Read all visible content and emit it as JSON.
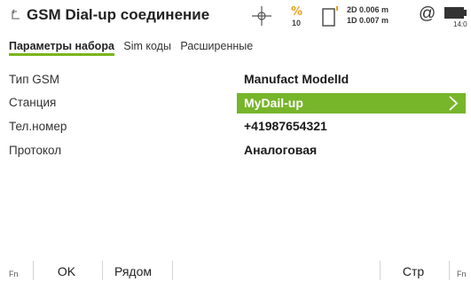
{
  "header": {
    "title": "GSM Dial-up соединение",
    "satellite_count": "10",
    "precision_2d": "2D 0.006 m",
    "precision_1d": "1D 0.007 m",
    "time": "14:0",
    "icons": [
      "back-icon",
      "crosshair-icon",
      "satellite-icon",
      "device-icon",
      "at-icon",
      "battery-icon"
    ]
  },
  "tabs": [
    {
      "label": "Параметры набора",
      "active": true
    },
    {
      "label": "Sim коды",
      "active": false
    },
    {
      "label": "Расширенные",
      "active": false
    }
  ],
  "fields": [
    {
      "label": "Тип GSM",
      "value": "Manufact ModelId"
    },
    {
      "label": "Станция",
      "value": "MyDail-up",
      "selected": true
    },
    {
      "label": "Тел.номер",
      "value": "+41987654321"
    },
    {
      "label": "Протокол",
      "value": "Аналоговая"
    }
  ],
  "footer": {
    "fn_left": "Fn",
    "ok_label": "OK",
    "nearby_label": "Рядом",
    "page_label": "Стр",
    "fn_right": "Fn"
  },
  "colors": {
    "accent_green": "#77b52a",
    "tab_underline": "#7ab51d"
  }
}
